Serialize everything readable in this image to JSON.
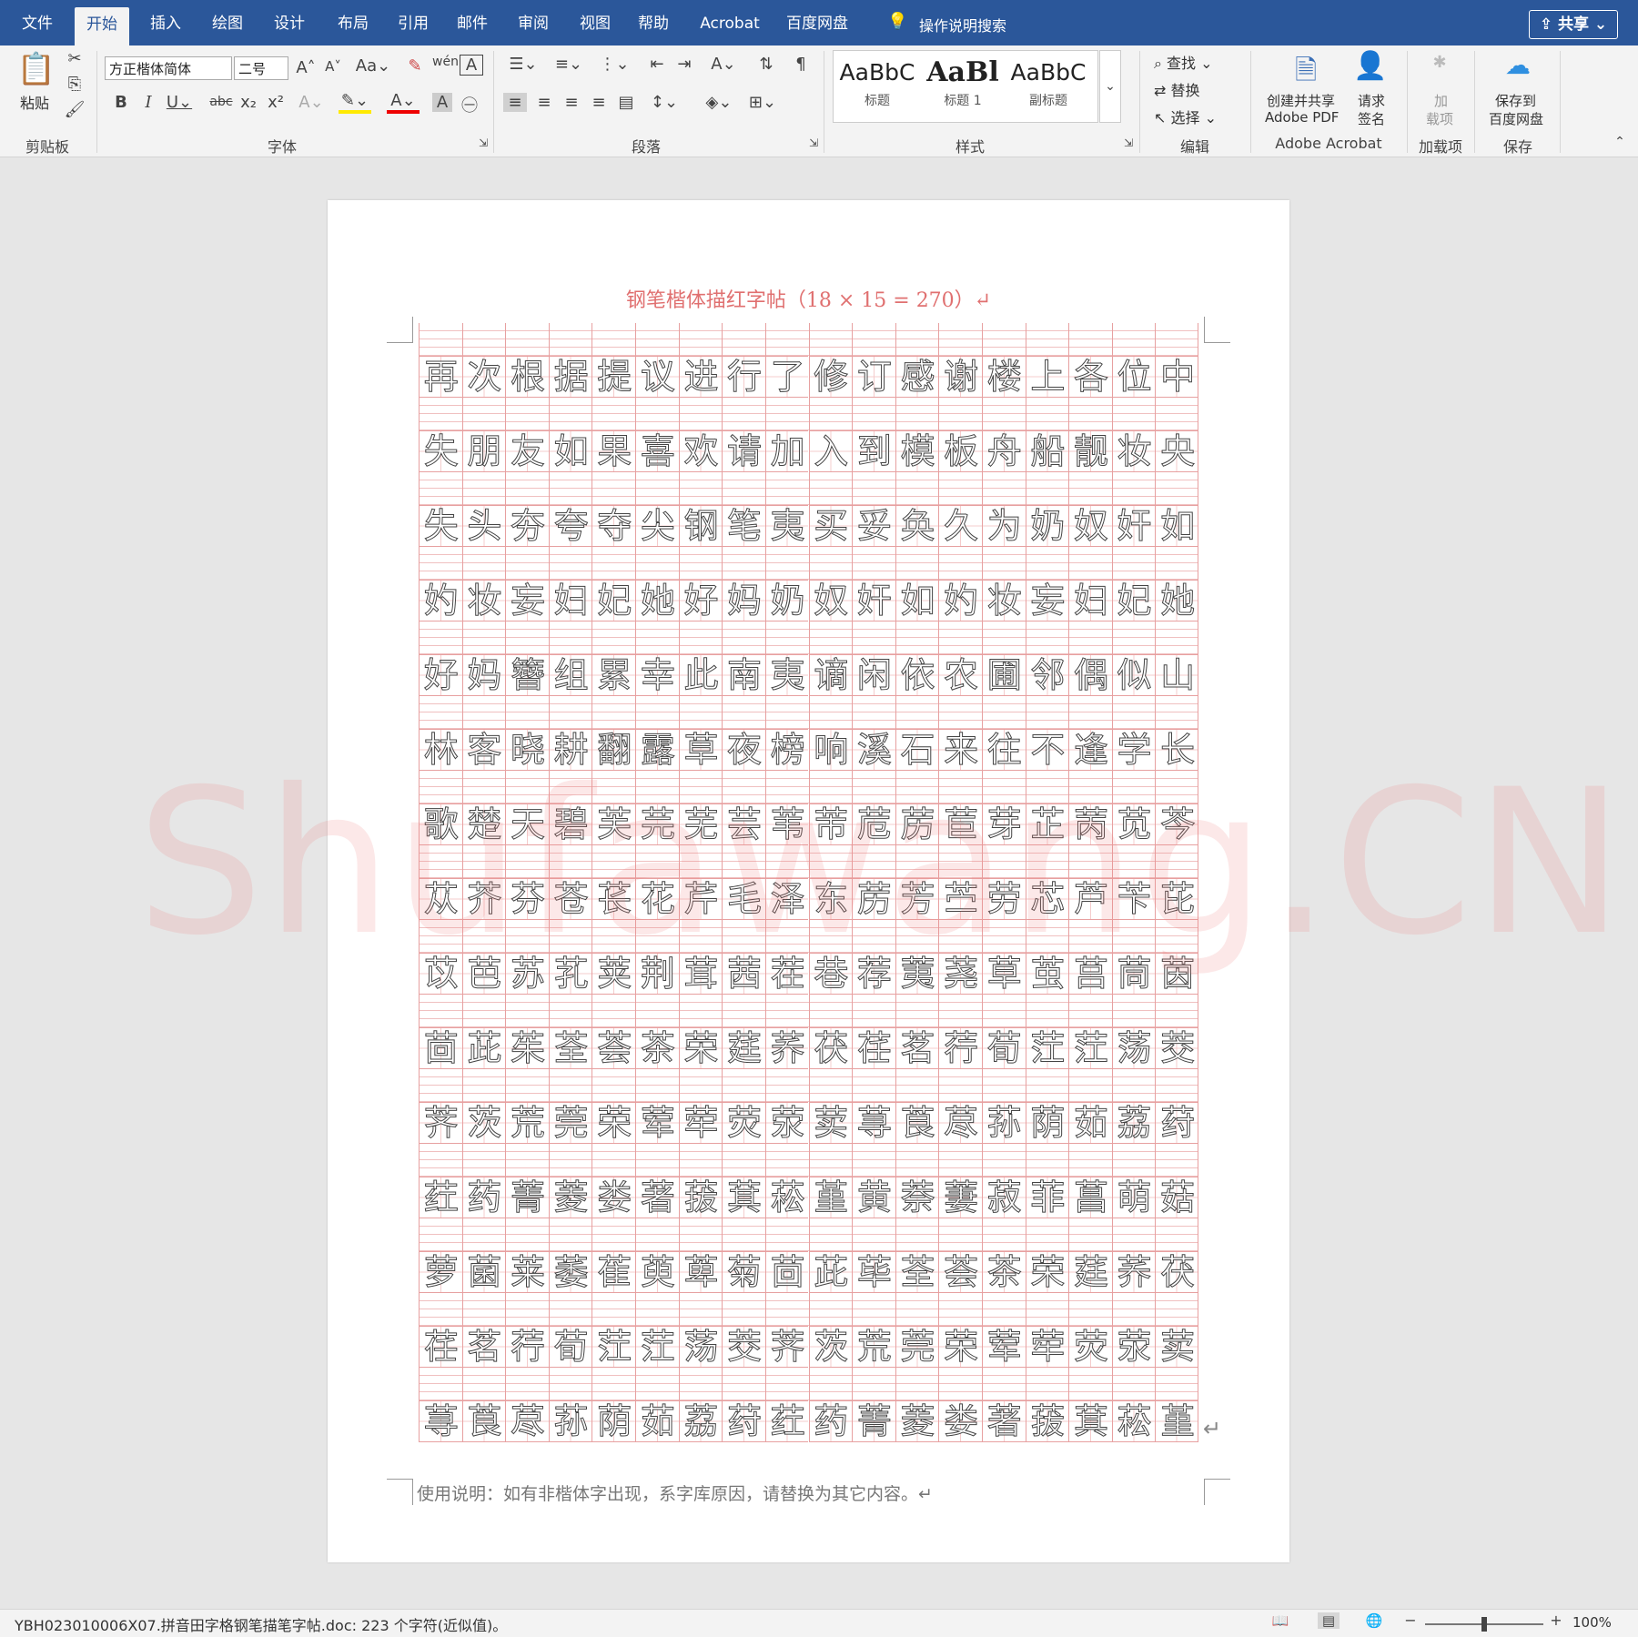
{
  "tabs": [
    "文件",
    "开始",
    "插入",
    "绘图",
    "设计",
    "布局",
    "引用",
    "邮件",
    "审阅",
    "视图",
    "帮助",
    "Acrobat",
    "百度网盘"
  ],
  "active_tab": "开始",
  "tell_me": "操作说明搜索",
  "share": "共享",
  "ribbon": {
    "paste": "粘贴",
    "font_name": "方正楷体简体",
    "font_size": "二号",
    "style_labels": [
      "标题",
      "标题 1",
      "副标题"
    ],
    "style_previews": [
      "AaBbC",
      "AaBl",
      "AaBbC"
    ],
    "find": "查找",
    "replace": "替换",
    "select": "选择",
    "create_pdf": "创建并共享",
    "create_pdf2": "Adobe PDF",
    "request_sign": "请求",
    "request_sign2": "签名",
    "addin": "加",
    "addin2": "载项",
    "save_baidu": "保存到",
    "save_baidu2": "百度网盘",
    "groups": [
      "剪贴板",
      "字体",
      "段落",
      "样式",
      "编辑",
      "Adobe Acrobat",
      "加载项",
      "保存"
    ]
  },
  "document": {
    "title": "钢笔楷体描红字帖（18 × 15 = 270）↵",
    "rows": [
      "再次根据提议进行了修订感谢楼上各位中",
      "失朋友如果喜欢请加入到模板舟船靓妆央",
      "失头夯夸夺尖钢笔夷买妥奂久为奶奴奸如",
      "妁妆妄妇妃她好妈奶奴奸如妁妆妄妇妃她",
      "好妈簪组累幸此南夷谪闲依农圃邻偶似山",
      "林客晓耕翻露草夜榜响溪石来往不逢学长",
      "歌楚天碧芙芫芜芸苇芾苊苈苣芽芷苪苋芩",
      "苁芥芬苍苌花芹毛泽东苈芳苎劳芯芦苄芘",
      "苡芭苏芤荚荆茸茜茬巷荐荑荛草茧莒茼茵",
      "茴茈茱荃荟茶荣莛荞茯荏茗荇荀茳茳荡茭",
      "荠茨荒莞荣荤荦荧荥荬荨莨荩荪荫茹荔荮",
      "荭药菁菱娄著菝萁菘堇黄萘萋菽菲菖萌菇",
      "萝菌莱萎萑萸萆菊茴茈荜荃荟茶荣莛荞茯",
      "荏茗荇荀茳茳荡茭荠茨荒莞荣荤荦荧荥荬",
      "荨莨荩荪荫茹荔荮荭药菁菱娄著菝萁菘堇"
    ],
    "note": "使用说明：如有非楷体字出现，系字库原因，请替换为其它内容。↵"
  },
  "watermark": "Shufawang.CN",
  "status": {
    "text": "YBH023010006X07.拼音田字格钢笔描笔字帖.doc: 223 个字符(近似值)。",
    "zoom": "100%"
  }
}
